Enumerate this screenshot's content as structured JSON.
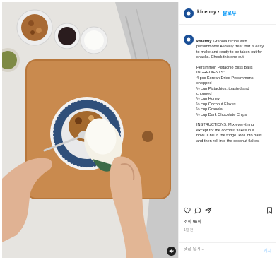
{
  "post": {
    "username": "kfnetmy",
    "separator": "•",
    "follow_label": "팔로우",
    "caption_user": "kfnetmy",
    "caption_lines": [
      "Granola recipe with",
      "persimmons! A lovely treat that is easy",
      "to make and ready to be taken out for",
      "snacks. Check this one out.",
      "",
      "Persimmon Pistachio Bliss Balls",
      "INGREDIENTS:",
      "4 pcs Korean Dried Persimmons,",
      "chopped",
      "½ cup Pistachios, toasted and",
      "chopped",
      "½ cup Honey",
      "½ cup Coconut Flakes",
      "½ cup Granola",
      "½ cup Dark Chocolate Chips",
      "",
      "INSTRUCTIONS: Mix everything",
      "except for the coconut flakes in a",
      "bowl. Chill in the fridge. Roll into balls",
      "and then roll into the coconut flakes."
    ],
    "likes_text": "조회 96회",
    "time_ago": "1일 전",
    "comment_placeholder": "댓글 달기...",
    "post_label": "게시"
  },
  "icons": {
    "avatar": "government-seal-avatar-icon",
    "like": "heart-icon",
    "comment": "comment-bubble-icon",
    "share": "paper-plane-icon",
    "save": "bookmark-icon",
    "sound": "speaker-mute-icon"
  },
  "colors": {
    "accent": "#0095f6",
    "avatar_bg": "#1a4f97",
    "text": "#262626",
    "muted": "#8e8e8e"
  }
}
